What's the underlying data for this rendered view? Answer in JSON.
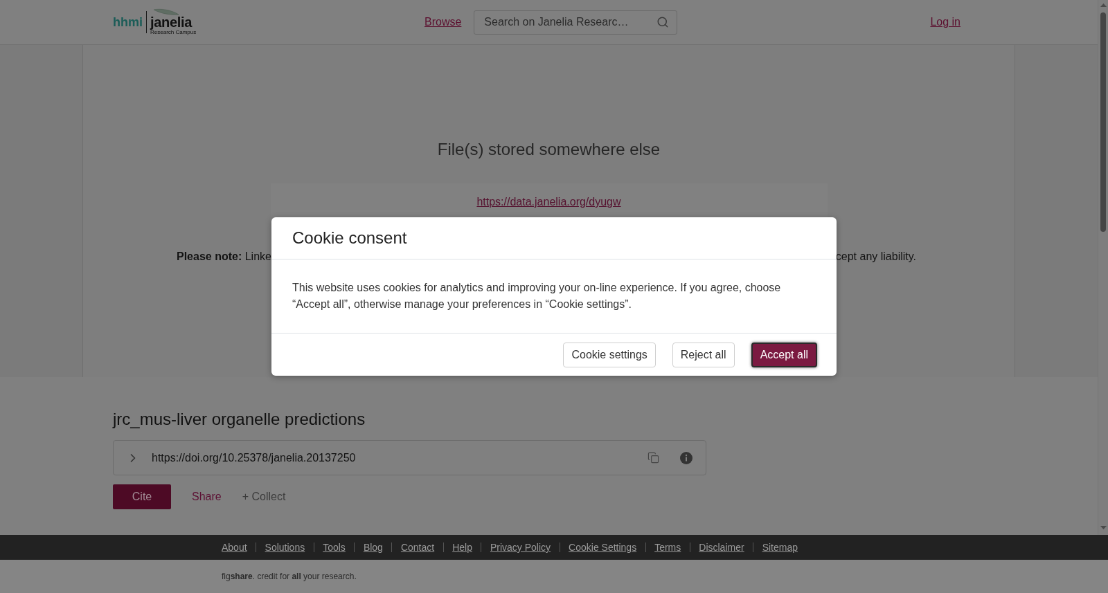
{
  "header": {
    "logo": {
      "mark": "hhmi",
      "name": "janelia",
      "tagline": "Research Campus"
    },
    "browse_link": "Browse",
    "search": {
      "placeholder": "Search on Janelia Researc…"
    },
    "login_link": "Log in"
  },
  "viewer": {
    "title": "File(s) stored somewhere else",
    "link": "https://data.janelia.org/dyugw",
    "note_visible_start": "**Please note:** Linke",
    "note_visible_end": "cept any liability."
  },
  "item": {
    "title": "jrc_mus-liver organelle predictions",
    "doi": "https://doi.org/10.25378/janelia.20137250",
    "actions": [
      {
        "kind": "primary",
        "label": "Cite"
      },
      {
        "kind": "link",
        "label": "Share"
      },
      {
        "kind": "muted",
        "label": "+ Collect"
      }
    ]
  },
  "footer": {
    "links": [
      "About",
      "Solutions",
      "Tools",
      "Blog",
      "Contact",
      "Help",
      "Privacy Policy",
      "Cookie Settings",
      "Terms",
      "Disclaimer",
      "Sitemap"
    ],
    "tagline": "fig**share**. credit for **all** your research."
  },
  "cookie_dialog": {
    "title": "Cookie consent",
    "message": "This website uses cookies for analytics and improving your on-line experience. If you agree, choose “Accept all”, otherwise manage your preferences in “Cookie settings”.",
    "buttons": [
      {
        "label": "Cookie settings",
        "kind": "secondary",
        "focused": false
      },
      {
        "label": "Reject all",
        "kind": "secondary",
        "focused": false
      },
      {
        "label": "Accept all",
        "kind": "primary",
        "focused": true
      }
    ]
  }
}
